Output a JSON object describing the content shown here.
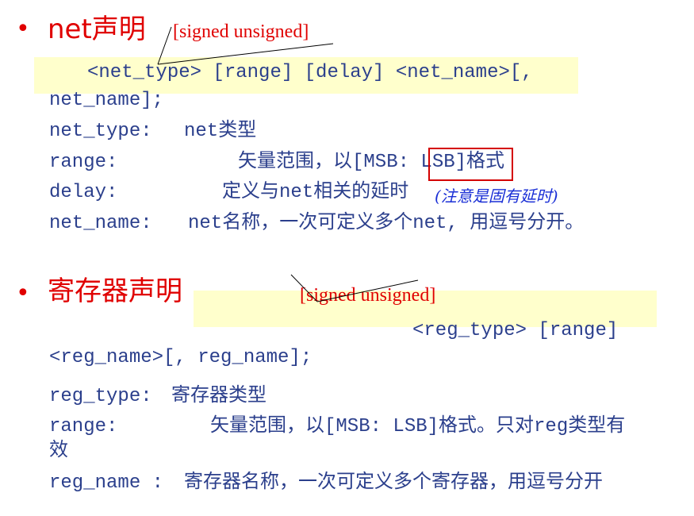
{
  "net_section": {
    "bullet": "•",
    "title": "net声明",
    "annotation": "[signed unsigned]",
    "syntax_line1": "<net_type> [range] [delay] <net_name>[,",
    "syntax_line2": "net_name];",
    "defs": [
      {
        "term": "net_type:",
        "desc": "net类型"
      },
      {
        "term": "range:",
        "desc": "矢量范围，以[MSB: LSB]格式"
      },
      {
        "term": "delay:",
        "desc": "定义与net相关的延时",
        "note": "(注意是固有延时)"
      },
      {
        "term": "net_name:",
        "desc": "net名称，一次可定义多个net, 用逗号分开。"
      }
    ]
  },
  "reg_section": {
    "bullet": "•",
    "title": "寄存器声明",
    "annotation": "[signed unsigned]",
    "syntax_line1": "<reg_type> [range]",
    "syntax_line2": "<reg_name>[, reg_name];",
    "defs": [
      {
        "term": "reg_type:",
        "desc": "寄存器类型"
      },
      {
        "term": "range:",
        "desc": "矢量范围，以[MSB: LSB]格式。只对reg类型有",
        "desc_cont": "效"
      },
      {
        "term": "reg_name :",
        "desc": "寄存器名称，一次可定义多个寄存器，用逗号分开"
      }
    ]
  },
  "colors": {
    "heading": "#e00000",
    "code": "#2b3f8c",
    "highlight": "#ffffcc",
    "note": "#1a2fd6"
  }
}
